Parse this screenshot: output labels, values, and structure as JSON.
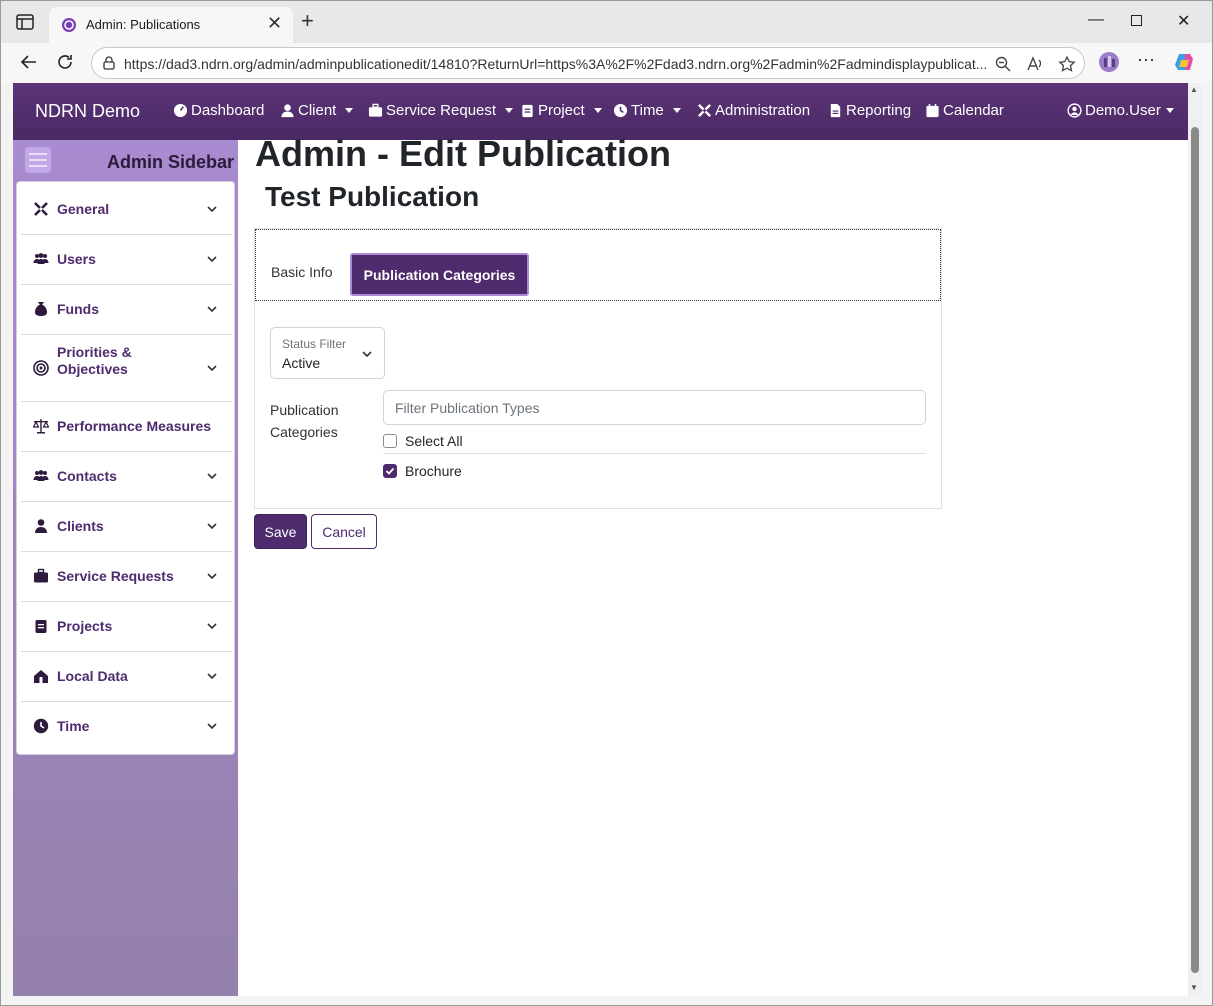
{
  "browser": {
    "tab_title": "Admin: Publications",
    "url": "https://dad3.ndrn.org/admin/adminpublicationedit/14810?ReturnUrl=https%3A%2F%2Fdad3.ndrn.org%2Fadmin%2Fadmindisplaypublicat..."
  },
  "navbar": {
    "brand": "NDRN Demo",
    "items": {
      "dashboard": "Dashboard",
      "client": "Client",
      "service_request": "Service Request",
      "project": "Project",
      "time": "Time",
      "administration": "Administration",
      "reporting": "Reporting",
      "calendar": "Calendar"
    },
    "user": "Demo.User"
  },
  "sidebar": {
    "title": "Admin Sidebar",
    "items": {
      "general": "General",
      "users": "Users",
      "funds": "Funds",
      "priorities": "Priorities & Objectives",
      "performance": "Performance Measures",
      "contacts": "Contacts",
      "clients": "Clients",
      "service_requests": "Service Requests",
      "projects": "Projects",
      "local_data": "Local Data",
      "time": "Time"
    }
  },
  "page": {
    "title": "Admin - Edit Publication",
    "subtitle": "Test Publication",
    "tabs": {
      "basic_info": "Basic Info",
      "publication_categories": "Publication Categories"
    },
    "status_filter": {
      "label": "Status Filter",
      "value": "Active"
    },
    "categories_label": "Publication Categories",
    "filter_placeholder": "Filter Publication Types",
    "select_all": "Select All",
    "options": [
      {
        "label": "Brochure",
        "checked": true
      }
    ],
    "save": "Save",
    "cancel": "Cancel"
  },
  "colors": {
    "brand_purple": "#4e2b6d",
    "sidebar_lavender": "#a88bd0"
  }
}
